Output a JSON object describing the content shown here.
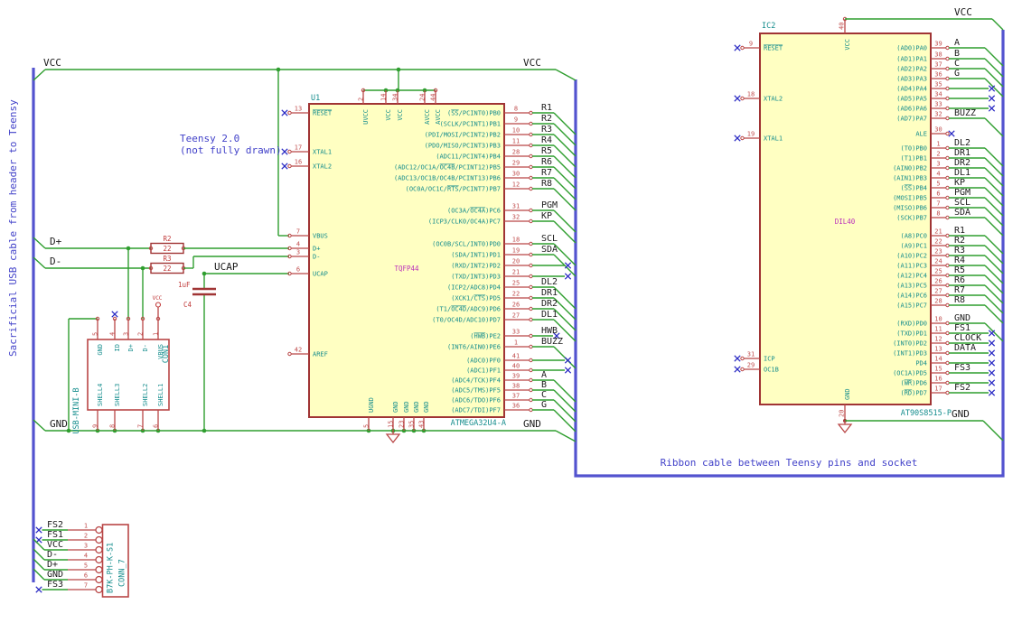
{
  "colors": {
    "wire": "#2f9e2f",
    "bus": "#5353cf",
    "note": "#4242c9",
    "outline": "#a03434",
    "pin": "#b94646",
    "pin_number": "#c14f4f",
    "field_red": "#c13a3a",
    "cyan": "#158d8d",
    "magenta": "#bb30bb",
    "label": "#1b1b1b",
    "no_connect": "#2a2ac4",
    "body_fill": "#ffffc2",
    "background": "#ffffff"
  },
  "notes": {
    "left_vertical": "Sacrificial USB cable from header to Teensy",
    "teensy_1": "Teensy 2.0",
    "teensy_2": "(not fully drawn)",
    "ribbon": "Ribbon cable between Teensy pins and socket"
  },
  "power_labels": {
    "vcc": "VCC",
    "gnd": "GND",
    "dplus": "D+",
    "dminus": "D-",
    "ucap": "UCAP"
  },
  "u1": {
    "ref": "U1",
    "value": "ATMEGA32U4-A",
    "package": "TQFP44",
    "top_pins": [
      {
        "num": "2",
        "name": "UVCC"
      },
      {
        "num": "14",
        "name": "VCC"
      },
      {
        "num": "34",
        "name": "VCC"
      },
      {
        "num": "24",
        "name": "AVCC"
      },
      {
        "num": "44",
        "name": "AVCC"
      }
    ],
    "bottom_pins": [
      {
        "num": "5",
        "name": "UGND"
      },
      {
        "num": "15",
        "name": "GND"
      },
      {
        "num": "23",
        "name": "GND"
      },
      {
        "num": "35",
        "name": "GND"
      },
      {
        "num": "43",
        "name": "GND"
      }
    ],
    "left_pins": [
      {
        "num": "13",
        "name": "{RESET}",
        "nc": true
      },
      {
        "num": "17",
        "name": "XTAL1",
        "nc": true
      },
      {
        "num": "16",
        "name": "XTAL2",
        "nc": true
      },
      {
        "num": "7",
        "name": "VBUS"
      },
      {
        "num": "4",
        "name": "D+"
      },
      {
        "num": "3",
        "name": "D-"
      },
      {
        "num": "6",
        "name": "UCAP"
      },
      {
        "num": "42",
        "name": "AREF"
      }
    ],
    "right_pins": [
      {
        "num": "8",
        "name": "({SS}/PCINT0)PB0",
        "label": "R1",
        "conn": "bus"
      },
      {
        "num": "9",
        "name": "(SCLK/PCINT1)PB1",
        "label": "R2",
        "conn": "bus"
      },
      {
        "num": "10",
        "name": "(PDI/MOSI/PCINT2)PB2",
        "label": "R3",
        "conn": "bus"
      },
      {
        "num": "11",
        "name": "(PDO/MISO/PCINT3)PB3",
        "label": "R4",
        "conn": "bus"
      },
      {
        "num": "28",
        "name": "(ADC11/PCINT4)PB4",
        "label": "R5",
        "conn": "bus"
      },
      {
        "num": "29",
        "name": "(ADC12/OC1A/{OC4B}/PCINT12)PB5",
        "label": "R6",
        "conn": "bus"
      },
      {
        "num": "30",
        "name": "(ADC13/OC1B/OC4B/PCINT13)PB6",
        "label": "R7",
        "conn": "bus"
      },
      {
        "num": "12",
        "name": "(OC0A/OC1C/{RTS}/PCINT7)PB7",
        "label": "R8",
        "conn": "bus"
      },
      {
        "num": "31",
        "name": "(OC3A/{OC4A})PC6",
        "label": "PGM",
        "conn": "bus"
      },
      {
        "num": "32",
        "name": "(ICP3/CLK0/OC4A)PC7",
        "label": "KP",
        "conn": "bus"
      },
      {
        "num": "18",
        "name": "(OC0B/SCL/INT0)PD0",
        "label": "SCL",
        "conn": "bus"
      },
      {
        "num": "19",
        "name": "(SDA/INT1)PD1",
        "label": "SDA",
        "conn": "bus"
      },
      {
        "num": "20",
        "name": "(RXD/INT2)PD2",
        "label": "",
        "conn": "nc_far"
      },
      {
        "num": "21",
        "name": "(TXD/INT3)PD3",
        "label": "",
        "conn": "nc_far"
      },
      {
        "num": "25",
        "name": "(ICP2/ADC8)PD4",
        "label": "DL2",
        "conn": "bus"
      },
      {
        "num": "22",
        "name": "(XCK1/{CTS})PD5",
        "label": "DR1",
        "conn": "bus"
      },
      {
        "num": "26",
        "name": "(T1/{OC4D}/ADC9)PD6",
        "label": "DR2",
        "conn": "bus"
      },
      {
        "num": "27",
        "name": "(T0/OC4D/ADC10)PD7",
        "label": "DL1",
        "conn": "bus"
      },
      {
        "num": "33",
        "name": "({HWB})PE2",
        "label": "HWB",
        "conn": "nc_near"
      },
      {
        "num": "1",
        "name": "(INT6/AIN0)PE6",
        "label": "BUZZ",
        "conn": "bus"
      },
      {
        "num": "41",
        "name": "(ADC0)PF0",
        "label": "",
        "conn": "nc_far"
      },
      {
        "num": "40",
        "name": "(ADC1)PF1",
        "label": "",
        "conn": "nc_far"
      },
      {
        "num": "39",
        "name": "(ADC4/TCK)PF4",
        "label": "A",
        "conn": "bus"
      },
      {
        "num": "38",
        "name": "(ADC5/TMS)PF5",
        "label": "B",
        "conn": "bus"
      },
      {
        "num": "37",
        "name": "(ADC6/TDO)PF6",
        "label": "C",
        "conn": "bus"
      },
      {
        "num": "36",
        "name": "(ADC7/TDI)PF7",
        "label": "G",
        "conn": "bus"
      }
    ]
  },
  "ic2": {
    "ref": "IC2",
    "value": "AT90S8515-P",
    "package": "DIL40",
    "top_pins": [
      {
        "num": "40",
        "name": "VCC"
      }
    ],
    "bottom_pins": [
      {
        "num": "20",
        "name": "GND"
      }
    ],
    "left_pins": [
      {
        "num": "9",
        "name": "{RESET}",
        "nc": true
      },
      {
        "num": "18",
        "name": "XTAL2",
        "nc": true
      },
      {
        "num": "19",
        "name": "XTAL1",
        "nc": true
      },
      {
        "num": "31",
        "name": "ICP",
        "nc": true
      },
      {
        "num": "29",
        "name": "OC1B",
        "nc": true
      }
    ],
    "right_pins": [
      {
        "num": "39",
        "name": "(AD0)PA0",
        "label": "A",
        "conn": "bus"
      },
      {
        "num": "38",
        "name": "(AD1)PA1",
        "label": "B",
        "conn": "bus"
      },
      {
        "num": "37",
        "name": "(AD2)PA2",
        "label": "C",
        "conn": "bus"
      },
      {
        "num": "36",
        "name": "(AD3)PA3",
        "label": "G",
        "conn": "bus"
      },
      {
        "num": "35",
        "name": "(AD4)PA4",
        "label": "",
        "conn": "nc_far"
      },
      {
        "num": "34",
        "name": "(AD5)PA5",
        "label": "",
        "conn": "nc_far"
      },
      {
        "num": "33",
        "name": "(AD6)PA6",
        "label": "",
        "conn": "nc_far"
      },
      {
        "num": "32",
        "name": "(AD7)PA7",
        "label": "BUZZ",
        "conn": "bus"
      },
      {
        "num": "30",
        "name": "ALE",
        "label": "",
        "conn": "nc_pin"
      },
      {
        "num": "1",
        "name": "(T0)PB0",
        "label": "DL2",
        "conn": "bus"
      },
      {
        "num": "2",
        "name": "(T1)PB1",
        "label": "DR1",
        "conn": "bus"
      },
      {
        "num": "3",
        "name": "(AIN0)PB2",
        "label": "DR2",
        "conn": "bus"
      },
      {
        "num": "4",
        "name": "(AIN1)PB3",
        "label": "DL1",
        "conn": "bus"
      },
      {
        "num": "5",
        "name": "({SS})PB4",
        "label": "KP",
        "conn": "bus"
      },
      {
        "num": "6",
        "name": "(MOSI)PB5",
        "label": "PGM",
        "conn": "bus"
      },
      {
        "num": "7",
        "name": "(MISO)PB6",
        "label": "SCL",
        "conn": "bus"
      },
      {
        "num": "8",
        "name": "(SCK)PB7",
        "label": "SDA",
        "conn": "bus"
      },
      {
        "num": "21",
        "name": "(A8)PC0",
        "label": "R1",
        "conn": "bus"
      },
      {
        "num": "22",
        "name": "(A9)PC1",
        "label": "R2",
        "conn": "bus"
      },
      {
        "num": "23",
        "name": "(A10)PC2",
        "label": "R3",
        "conn": "bus"
      },
      {
        "num": "24",
        "name": "(A11)PC3",
        "label": "R4",
        "conn": "bus"
      },
      {
        "num": "25",
        "name": "(A12)PC4",
        "label": "R5",
        "conn": "bus"
      },
      {
        "num": "26",
        "name": "(A13)PC5",
        "label": "R6",
        "conn": "bus"
      },
      {
        "num": "27",
        "name": "(A14)PC6",
        "label": "R7",
        "conn": "bus"
      },
      {
        "num": "28",
        "name": "(A15)PC7",
        "label": "R8",
        "conn": "bus"
      },
      {
        "num": "10",
        "name": "(RXD)PD0",
        "label": "GND",
        "conn": "bus"
      },
      {
        "num": "11",
        "name": "(TXD)PD1",
        "label": "FS1",
        "conn": "nc_far"
      },
      {
        "num": "12",
        "name": "(INT0)PD2",
        "label": "CLOCK",
        "conn": "nc_far"
      },
      {
        "num": "13",
        "name": "(INT1)PD3",
        "label": "DATA",
        "conn": "nc_far"
      },
      {
        "num": "14",
        "name": "PD4",
        "label": "",
        "conn": "nc_far"
      },
      {
        "num": "15",
        "name": "(OC1A)PD5",
        "label": "FS3",
        "conn": "nc_far"
      },
      {
        "num": "16",
        "name": "({WR})PD6",
        "label": "",
        "conn": "nc_far"
      },
      {
        "num": "17",
        "name": "({RD})PD7",
        "label": "FS2",
        "conn": "nc_far"
      }
    ]
  },
  "con1": {
    "ref": "CON1",
    "value": "USB-MINI-B",
    "top_pins": [
      {
        "num": "5",
        "name": "GND"
      },
      {
        "num": "4",
        "name": "ID",
        "nc": true
      },
      {
        "num": "3",
        "name": "D+"
      },
      {
        "num": "2",
        "name": "D-"
      },
      {
        "num": "1",
        "name": "VBUS"
      }
    ],
    "bottom_pins": [
      {
        "num": "9",
        "name": "SHELL4"
      },
      {
        "num": "8",
        "name": "SHELL3"
      },
      {
        "num": "7",
        "name": "SHELL2"
      },
      {
        "num": "6",
        "name": "SHELL1"
      }
    ]
  },
  "conn7": {
    "ref": "CONN_7",
    "value": "B7K-PH-K-S1",
    "pins": [
      {
        "num": "1",
        "label": "FS2",
        "nc": true
      },
      {
        "num": "2",
        "label": "FS1",
        "nc": true
      },
      {
        "num": "3",
        "label": "VCC"
      },
      {
        "num": "4",
        "label": "D-"
      },
      {
        "num": "5",
        "label": "D+"
      },
      {
        "num": "6",
        "label": "GND"
      },
      {
        "num": "7",
        "label": "FS3",
        "nc": true
      }
    ]
  },
  "r2": {
    "ref": "R2",
    "value": "22"
  },
  "r3": {
    "ref": "R3",
    "value": "22"
  },
  "c4": {
    "ref": "C4",
    "value": "1uF"
  },
  "vcc_symbol_label": "VCC"
}
